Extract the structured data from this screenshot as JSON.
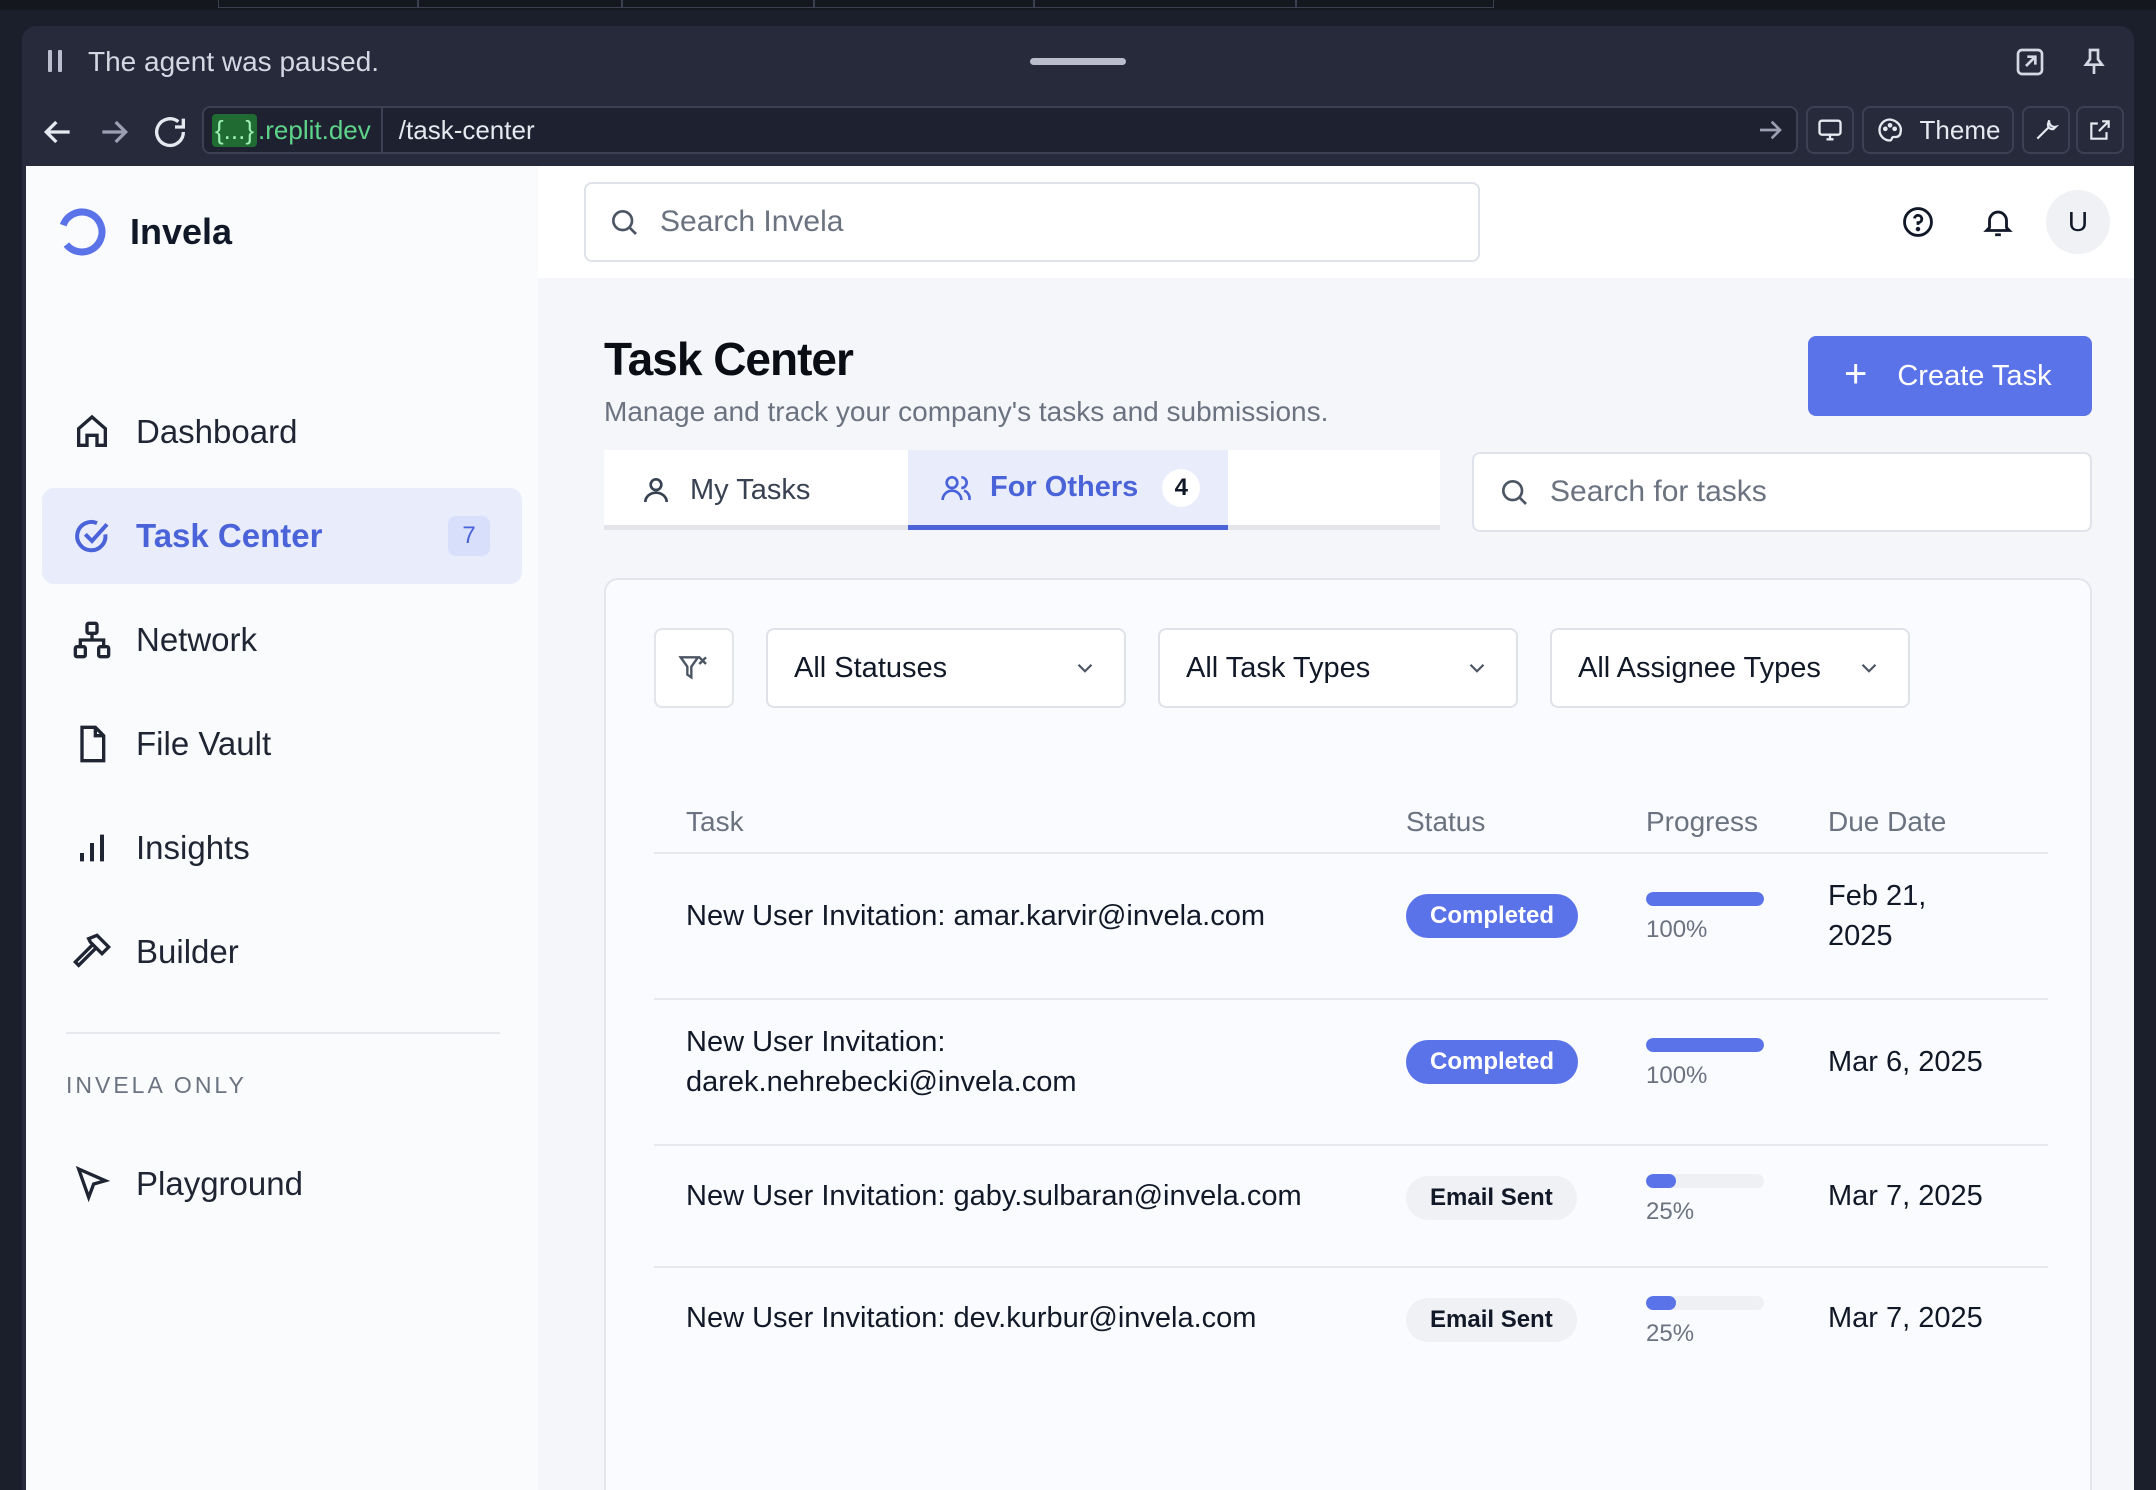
{
  "agent_bar": {
    "status_text": "The agent was paused."
  },
  "browser": {
    "url_host_brace": "{...}",
    "url_host": ".replit.dev",
    "url_path": "/task-center",
    "theme_label": "Theme"
  },
  "app": {
    "name": "Invela",
    "search_placeholder": "Search Invela",
    "avatar_initial": "U"
  },
  "sidebar": {
    "items": [
      {
        "label": "Dashboard",
        "icon": "home-icon"
      },
      {
        "label": "Task Center",
        "icon": "check-circle-icon",
        "badge": "7",
        "active": true
      },
      {
        "label": "Network",
        "icon": "network-icon"
      },
      {
        "label": "File Vault",
        "icon": "file-icon"
      },
      {
        "label": "Insights",
        "icon": "bar-chart-icon"
      },
      {
        "label": "Builder",
        "icon": "hammer-icon"
      }
    ],
    "section_label": "INVELA ONLY",
    "section_items": [
      {
        "label": "Playground",
        "icon": "cursor-arrow-icon"
      }
    ]
  },
  "page": {
    "title": "Task Center",
    "subtitle": "Manage and track your company's tasks and submissions.",
    "create_button": "Create Task",
    "tabs": [
      {
        "label": "My Tasks",
        "icon": "user-icon"
      },
      {
        "label": "For Others",
        "icon": "users-icon",
        "count": "4",
        "active": true
      }
    ],
    "task_search_placeholder": "Search for tasks",
    "filters": {
      "status": "All Statuses",
      "task_type": "All Task Types",
      "assignee_type": "All Assignee Types"
    },
    "table": {
      "headers": [
        "Task",
        "Status",
        "Progress",
        "Due Date"
      ],
      "rows": [
        {
          "task": "New User Invitation: amar.karvir@invela.com",
          "status": "Completed",
          "progress": 100,
          "progress_label": "100%",
          "due_date": "Feb 21, 2025"
        },
        {
          "task": "New User Invitation: darek.nehrebecki@invela.com",
          "status": "Completed",
          "progress": 100,
          "progress_label": "100%",
          "due_date": "Mar 6, 2025"
        },
        {
          "task": "New User Invitation: gaby.sulbaran@invela.com",
          "status": "Email Sent",
          "progress": 25,
          "progress_label": "25%",
          "due_date": "Mar 7, 2025"
        },
        {
          "task": "New User Invitation: dev.kurbur@invela.com",
          "status": "Email Sent",
          "progress": 25,
          "progress_label": "25%",
          "due_date": "Mar 7, 2025"
        }
      ]
    }
  },
  "colors": {
    "accent": "#5b73e8",
    "accent_text": "#4a63d9",
    "active_bg": "#e9edfb"
  }
}
